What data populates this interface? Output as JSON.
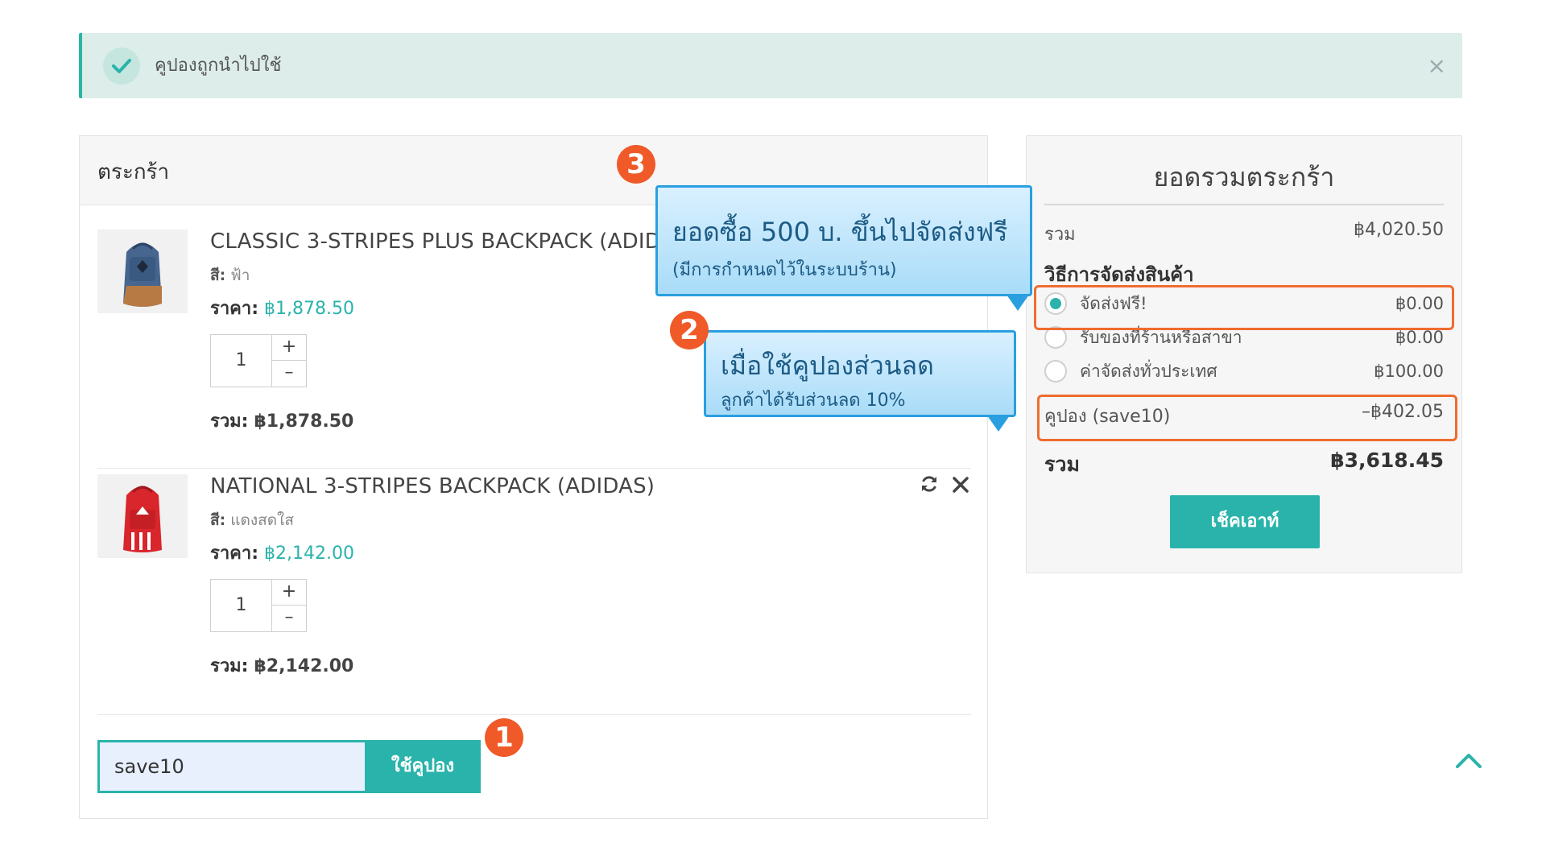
{
  "alert": {
    "message": "คูปองถูกนำไปใช้",
    "close": "×"
  },
  "cart": {
    "title": "ตระกร้า",
    "items": [
      {
        "name": "CLASSIC 3-STRIPES PLUS BACKPACK (ADIDAS)",
        "color_label": "สี:",
        "color_value": "ฟ้า",
        "price_label": "ราคา:",
        "price_value": "฿1,878.50",
        "quantity": "1",
        "plus": "+",
        "minus": "–",
        "subtotal_label": "รวม:",
        "subtotal_value": "฿1,878.50"
      },
      {
        "name": "NATIONAL 3-STRIPES BACKPACK (ADIDAS)",
        "color_label": "สี:",
        "color_value": "แดงสดใส",
        "price_label": "ราคา:",
        "price_value": "฿2,142.00",
        "quantity": "1",
        "plus": "+",
        "minus": "–",
        "subtotal_label": "รวม:",
        "subtotal_value": "฿2,142.00"
      }
    ],
    "coupon": {
      "value": "save10",
      "button": "ใช้คูปอง"
    }
  },
  "summary": {
    "title": "ยอดรวมตระกร้า",
    "subtotal_label": "รวม",
    "subtotal_value": "฿4,020.50",
    "shipping_heading": "วิธีการจัดส่งสินค้า",
    "shipping_options": [
      {
        "label": "จัดส่งฟรี!",
        "price": "฿0.00",
        "selected": true
      },
      {
        "label": "รับของที่ร้านหรือสาขา",
        "price": "฿0.00",
        "selected": false
      },
      {
        "label": "ค่าจัดส่งทั่วประเทศ",
        "price": "฿100.00",
        "selected": false
      }
    ],
    "coupon_label": "คูปอง (save10)",
    "coupon_value": "–฿402.05",
    "total_label": "รวม",
    "total_value": "฿3,618.45",
    "checkout": "เช็คเอาท์"
  },
  "callouts": {
    "badge_1": "1",
    "badge_2": "2",
    "badge_3": "3",
    "bubble_3_main": "ยอดซื้อ 500 บ. ขึ้นไปจัดส่งฟรี",
    "bubble_3_sub": "(มีการกำหนดไว้ในระบบร้าน)",
    "bubble_2_main": "เมื่อใช้คูปองส่วนลด",
    "bubble_2_sub": "ลูกค้าได้รับส่วนลด  10%"
  },
  "colors": {
    "accent": "#2ab3ab",
    "highlight": "#ef6c2f",
    "badge": "#ef5a28",
    "bubble_border": "#2a9fe0"
  },
  "icons": {
    "alert": "check-icon",
    "refresh": "refresh-icon",
    "remove": "close-icon",
    "scroll": "chevron-up-icon"
  }
}
